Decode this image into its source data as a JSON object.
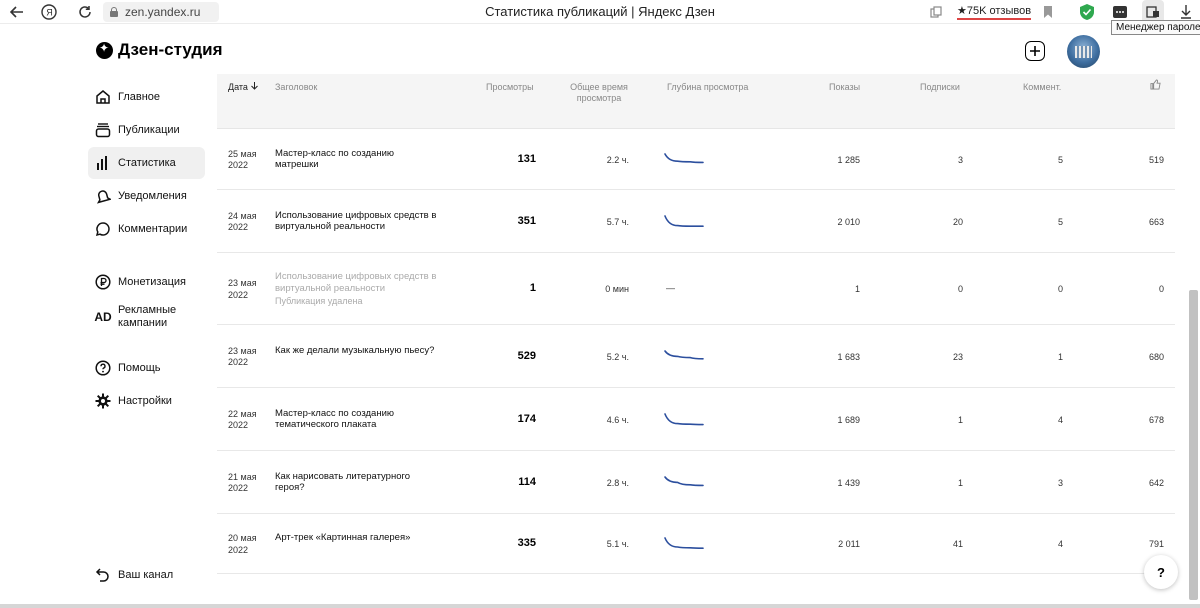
{
  "browser": {
    "url": "zen.yandex.ru",
    "tab_title": "Статистика публикаций | Яндекс Дзен",
    "reviews_badge": "★75K отзывов",
    "tooltip": "Менеджер паролей"
  },
  "app": {
    "logo_text": "Дзен-студия"
  },
  "sidebar": {
    "items": [
      {
        "label": "Главное",
        "icon": "home-icon"
      },
      {
        "label": "Публикации",
        "icon": "stack-icon"
      },
      {
        "label": "Статистика",
        "icon": "bar-chart-icon"
      },
      {
        "label": "Уведомления",
        "icon": "bell-icon"
      },
      {
        "label": "Комментарии",
        "icon": "comment-icon"
      },
      {
        "label": "Монетизация",
        "icon": "ruble-icon"
      },
      {
        "label": "Рекламные кампании",
        "icon": "ad-icon"
      },
      {
        "label": "Помощь",
        "icon": "question-icon"
      },
      {
        "label": "Настройки",
        "icon": "gear-icon"
      }
    ],
    "your_channel": "Ваш канал",
    "active_item": "Статистика"
  },
  "table": {
    "columns": {
      "date": "Дата",
      "title": "Заголовок",
      "views": "Просмотры",
      "total_time": "Общее время просмотра",
      "depth": "Глубина просмотра",
      "impressions": "Показы",
      "subscriptions": "Подписки",
      "comments": "Коммент."
    },
    "rows": [
      {
        "date": "25 мая 2022",
        "title": "Мастер-класс по созданию матрешки",
        "views": "131",
        "time": "2.2 ч.",
        "depth": [
          1,
          0.4,
          0.35,
          0.3
        ],
        "impressions": "1 285",
        "subs": "3",
        "comments": "5",
        "likes": "519",
        "deleted": false,
        "status": ""
      },
      {
        "date": "24 мая 2022",
        "title": "Использование цифровых средств в виртуальной реальности",
        "views": "351",
        "time": "5.7 ч.",
        "depth": [
          1,
          0.2,
          0.15,
          0.15
        ],
        "impressions": "2 010",
        "subs": "20",
        "comments": "5",
        "likes": "663",
        "deleted": false,
        "status": ""
      },
      {
        "date": "23 мая 2022",
        "title": "Использование цифровых средств в виртуальной реальности",
        "views": "1",
        "time": "0 мин",
        "depth": null,
        "depth_text": "—",
        "impressions": "1",
        "subs": "0",
        "comments": "0",
        "likes": "0",
        "deleted": true,
        "status": "Публикация удалена"
      },
      {
        "date": "23 мая 2022",
        "title": "Как же делали музыкальную пьесу?",
        "views": "529",
        "time": "5.2 ч.",
        "depth": [
          1,
          0.55,
          0.45,
          0.35
        ],
        "impressions": "1 683",
        "subs": "23",
        "comments": "1",
        "likes": "680",
        "deleted": false,
        "status": ""
      },
      {
        "date": "22 мая 2022",
        "title": "Мастер-класс по созданию тематического плаката",
        "views": "174",
        "time": "4.6 ч.",
        "depth": [
          1,
          0.2,
          0.15,
          0.12
        ],
        "impressions": "1 689",
        "subs": "1",
        "comments": "4",
        "likes": "678",
        "deleted": false,
        "status": ""
      },
      {
        "date": "21 мая 2022",
        "title": "Как нарисовать литературного героя?",
        "views": "114",
        "time": "2.8 ч.",
        "depth": [
          1,
          0.55,
          0.35,
          0.3
        ],
        "impressions": "1 439",
        "subs": "1",
        "comments": "3",
        "likes": "642",
        "deleted": false,
        "status": ""
      },
      {
        "date": "20 мая 2022",
        "title": "Арт-трек «Картинная галерея»",
        "views": "335",
        "time": "5.1 ч.",
        "depth": [
          1,
          0.25,
          0.18,
          0.15
        ],
        "impressions": "2 011",
        "subs": "41",
        "comments": "4",
        "likes": "791",
        "deleted": false,
        "status": ""
      }
    ]
  },
  "colors": {
    "sparkline": "#2c4f9e",
    "active_nav_bg": "#f0f0f0",
    "header_bg": "#f5f5f5"
  },
  "help_button": "?"
}
